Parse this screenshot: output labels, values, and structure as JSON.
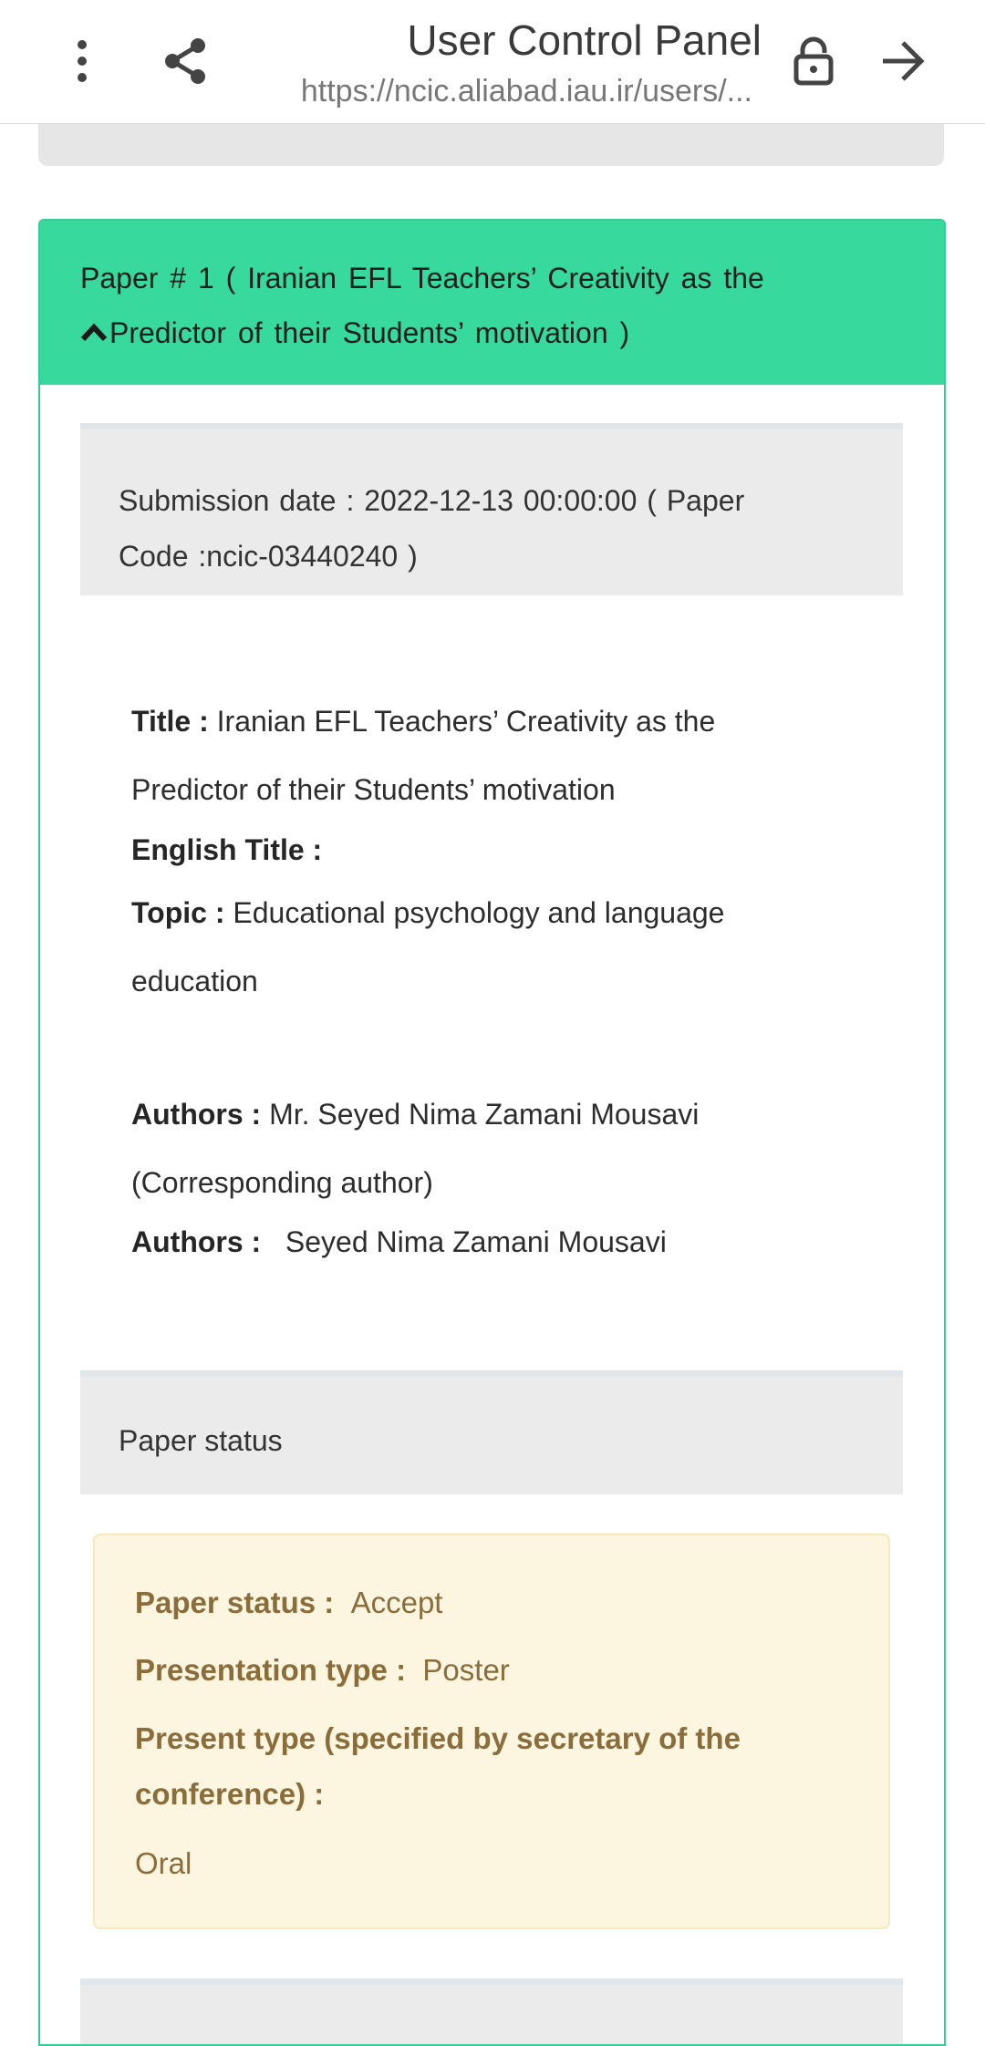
{
  "toolbar": {
    "title": "User Control Panel",
    "url": "https://ncic.aliabad.iau.ir/users/...",
    "icons": [
      "more-vert-icon",
      "share-icon",
      "lock-icon",
      "arrow-forward-icon"
    ]
  },
  "paper": {
    "header_line1": "Paper # 1 ( Iranian EFL Teachers’ Creativity as the",
    "header_line2": "Predictor of their Students’ motivation )",
    "submission_line1": "Submission date : 2022-12-13 00:00:00 ( Paper",
    "submission_line2": "Code :ncic-03440240 )",
    "title_label": "Title :",
    "title_value_line1": "Iranian EFL Teachers’ Creativity as the",
    "title_value_line2": "Predictor of their Students’ motivation",
    "english_title_label": "English Title :",
    "topic_label": "Topic :",
    "topic_value_line1": "Educational psychology and language",
    "topic_value_line2": "education",
    "authors_label": "Authors :",
    "authors_value_line1": "Mr. Seyed Nima Zamani Mousavi",
    "authors_value_line2": "(Corresponding author)",
    "authors2_label": "Authors :",
    "authors2_value": "Seyed Nima Zamani Mousavi"
  },
  "status": {
    "section_title": "Paper status",
    "paper_status_label": "Paper status :",
    "paper_status_value": "Accept",
    "presentation_type_label": "Presentation type :",
    "presentation_type_value": "Poster",
    "present_type_label_line1": "Present type (specified by secretary of the",
    "present_type_label_line2": "conference) :",
    "present_type_value": "Oral"
  },
  "colors": {
    "header_green": "#37d99c",
    "card_border": "#33cc99",
    "alert_bg": "#fcf6e0",
    "alert_text": "#8a6d3b",
    "well_bg": "#ebebeb"
  }
}
